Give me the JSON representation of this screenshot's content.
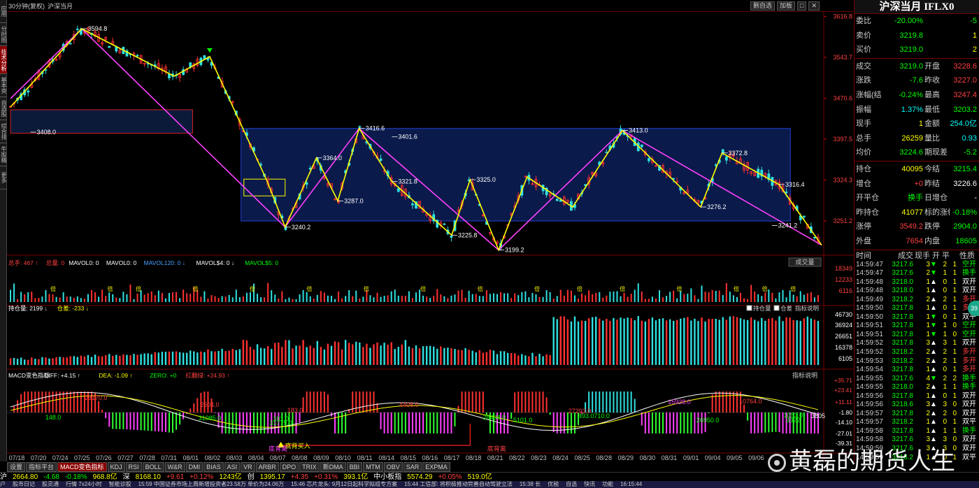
{
  "window": {
    "period": "30分钟(复权)",
    "symbol_short": "沪深当月",
    "tool_buttons": [
      "删自选",
      "加板",
      "□",
      "✕"
    ]
  },
  "left_tabs": [
    {
      "label": "应用",
      "active": false
    },
    {
      "label": "分时图",
      "active": false
    },
    {
      "label": "技术分析",
      "active": true
    },
    {
      "label": "基本资料",
      "active": false
    },
    {
      "label": "自选股",
      "active": false
    },
    {
      "label": "综合排名",
      "active": false
    },
    {
      "label": "牛股精选",
      "active": false
    },
    {
      "label": "更多",
      "active": false
    }
  ],
  "main_panel": {
    "price_ticks": [
      "3616.8",
      "3543.7",
      "3470.6",
      "3397.5",
      "3324.3",
      "3251.2"
    ],
    "annotations": [
      {
        "text": "3594.8"
      },
      {
        "text": "3408.0"
      },
      {
        "text": "3416.6"
      },
      {
        "text": "3401.6"
      },
      {
        "text": "3364.0"
      },
      {
        "text": "3321.8"
      },
      {
        "text": "3287.0"
      },
      {
        "text": "3325.0"
      },
      {
        "text": "3240.2"
      },
      {
        "text": "3225.8"
      },
      {
        "text": "3199.2"
      },
      {
        "text": "3413.0"
      },
      {
        "text": "3372.8"
      },
      {
        "text": "3316.4"
      },
      {
        "text": "3276.2"
      },
      {
        "text": "3241.2"
      }
    ]
  },
  "volume_panel": {
    "header": [
      {
        "text": "总手: 467 ↑",
        "color": "#ff4040"
      },
      {
        "text": "总量: 0",
        "color": "#ff4040"
      },
      {
        "text": "MAVOL0: 0",
        "color": "#ffffff"
      },
      {
        "text": "MAVOL0: 0",
        "color": "#ffffff"
      },
      {
        "text": "MAVOL120: 0 ↓",
        "color": "#4aa0ff"
      },
      {
        "text": "MAVOL$4: 0 ↓",
        "color": "#ffffff"
      },
      {
        "text": "MAVOL$5: 0",
        "color": "#00ff00"
      }
    ],
    "button": "成交量",
    "ticks": [
      "18349",
      "12233",
      "6116"
    ],
    "marker": "倍"
  },
  "oi_panel": {
    "header": [
      {
        "text": "持仓量: 2199 ↓",
        "color": "#ffffff"
      },
      {
        "text": "仓差: -233 ↓",
        "color": "#ffff00"
      }
    ],
    "checks": [
      "持仓量",
      "仓差",
      "指标说明"
    ],
    "ticks": [
      "46730",
      "36924",
      "26651",
      "16378",
      "6105"
    ]
  },
  "macd_panel": {
    "header": [
      {
        "text": "MACD变色指标",
        "color": "#ffffff"
      },
      {
        "text": "DIFF: +4.15 ↑",
        "color": "#ffffff"
      },
      {
        "text": "DEA: -1.09 ↑",
        "color": "#ffff00"
      },
      {
        "text": "ZERO: +0",
        "color": "#00ff00"
      },
      {
        "text": "红翻绿: +24.93 ↑",
        "color": "#ff4040"
      }
    ],
    "button": "指标说明",
    "ticks": [
      "+35.71",
      "+23.41",
      "+11.11",
      "-1.80",
      "-14.10",
      "-27.01",
      "-39.31"
    ],
    "labels": [
      {
        "text": "28170.0"
      },
      {
        "text": "2604.0"
      },
      {
        "text": "148.0"
      },
      {
        "text": "31085.0"
      },
      {
        "text": "101.0"
      },
      {
        "text": "31779.0"
      },
      {
        "text": "183.0"
      },
      {
        "text": "4408.0"
      },
      {
        "text": "28408.0"
      },
      {
        "text": "5101.0"
      },
      {
        "text": "27293.0"
      },
      {
        "text": "493.0710.0"
      },
      {
        "text": "15928.0"
      },
      {
        "text": "10764.0"
      },
      {
        "text": "26950.0"
      },
      {
        "text": "3322"
      },
      {
        "text": "1053.0"
      },
      {
        "text": "3805"
      }
    ],
    "signal_buy": "底背买入",
    "signal_top": "底背离",
    "signal_top2": "底背离"
  },
  "date_axis": [
    "07/18",
    "07/20",
    "07/24",
    "07/25",
    "07/26",
    "07/27",
    "07/28",
    "07/31",
    "08/01",
    "08/02",
    "08/03",
    "08/04",
    "08/07",
    "08/08",
    "08/09",
    "08/10",
    "08/11",
    "08/14",
    "08/15",
    "08/16",
    "08/17",
    "08/18",
    "08/21",
    "08/22",
    "08/23",
    "08/24",
    "08/25",
    "08/28",
    "08/29",
    "08/30",
    "08/31",
    "09/01",
    "09/04",
    "09/05",
    "09/06"
  ],
  "bottom_tabs": [
    {
      "label": "设置",
      "active": false
    },
    {
      "label": "指标平台",
      "active": false
    },
    {
      "label": "MACD变色指标",
      "active": true
    },
    {
      "label": "KDJ",
      "active": false
    },
    {
      "label": "RSI",
      "active": false
    },
    {
      "label": "BOLL",
      "active": false
    },
    {
      "label": "W&R",
      "active": false
    },
    {
      "label": "DMI",
      "active": false
    },
    {
      "label": "BIAS",
      "active": false
    },
    {
      "label": "ASI",
      "active": false
    },
    {
      "label": "VR",
      "active": false
    },
    {
      "label": "ARBR",
      "active": false
    },
    {
      "label": "DPO",
      "active": false
    },
    {
      "label": "TRIX",
      "active": false
    },
    {
      "label": "新DMA",
      "active": false
    },
    {
      "label": "BBI",
      "active": false
    },
    {
      "label": "MTM",
      "active": false
    },
    {
      "label": "OBV",
      "active": false
    },
    {
      "label": "SAR",
      "active": false
    },
    {
      "label": "EXPMA",
      "active": false
    }
  ],
  "index_bar": [
    {
      "text": "沪",
      "color": "#ffffff"
    },
    {
      "text": "2664.80",
      "color": "#ffff00"
    },
    {
      "text": "-4.68",
      "color": "#00ff00"
    },
    {
      "text": "-0.18%",
      "color": "#00ff00"
    },
    {
      "text": "968.8亿",
      "color": "#ffff00"
    },
    {
      "text": "深",
      "color": "#ffffff"
    },
    {
      "text": "8168.10",
      "color": "#ffff00"
    },
    {
      "text": "+9.61",
      "color": "#ff4040"
    },
    {
      "text": "+0.12%",
      "color": "#ff4040"
    },
    {
      "text": "1243亿",
      "color": "#ffff00"
    },
    {
      "text": "创",
      "color": "#ffffff"
    },
    {
      "text": "1395.17",
      "color": "#ffff00"
    },
    {
      "text": "+4.35",
      "color": "#ff4040"
    },
    {
      "text": "+0.31%",
      "color": "#ff4040"
    },
    {
      "text": "393.1亿",
      "color": "#ffff00"
    },
    {
      "text": "中小板指",
      "color": "#ffffff"
    },
    {
      "text": "5574.29",
      "color": "#ffff00"
    },
    {
      "text": "+0.05%",
      "color": "#ff4040"
    },
    {
      "text": "519.0亿",
      "color": "#ffff00"
    }
  ],
  "status_bar": [
    "户",
    "股市日记",
    "股灵通",
    "行情 7x24小时",
    "智能诊股",
    "15:59 中国证券市场上周新增投资者23.58万 单价为24.06万",
    "15:46 芯片龙头: 9月12日起科学拟组专方案",
    "15:44 工信部: 将积极推动完善自动驾驶立法",
    "15:38 长",
    "优税",
    "自选",
    "快讯",
    "功能",
    "16:15:44"
  ],
  "quote_panel": {
    "title": "沪深当月 IFLX0",
    "rows": [
      {
        "l1": "委比",
        "v1": "-20.00%",
        "c1": "#00ff00",
        "l2": "",
        "v2": "-5",
        "c2": "#00ff00"
      },
      {
        "l1": "卖价",
        "v1": "3219.8",
        "c1": "#00ff00",
        "l2": "",
        "v2": "1",
        "c2": "#ffff00"
      },
      {
        "l1": "买价",
        "v1": "3219.0",
        "c1": "#00ff00",
        "l2": "",
        "v2": "2",
        "c2": "#ffff00"
      },
      {
        "sep": true
      },
      {
        "l1": "成交",
        "v1": "3219.0",
        "c1": "#00ff00",
        "l2": "开盘",
        "v2": "3228.6",
        "c2": "#ff4040"
      },
      {
        "l1": "涨跌",
        "v1": "-7.6",
        "c1": "#00ff00",
        "l2": "昨收",
        "v2": "3227.0",
        "c2": "#ff4040"
      },
      {
        "l1": "涨幅(结)",
        "v1": "-0.24%",
        "c1": "#00ff00",
        "l2": "最高",
        "v2": "3247.4",
        "c2": "#ff4040"
      },
      {
        "l1": "振幅",
        "v1": "1.37%",
        "c1": "#00ffff",
        "l2": "最低",
        "v2": "3203.2",
        "c2": "#00ff00"
      },
      {
        "l1": "现手",
        "v1": "1",
        "c1": "#ffff00",
        "l2": "金额",
        "v2": "254.0亿",
        "c2": "#00ffff"
      },
      {
        "l1": "总手",
        "v1": "26259",
        "c1": "#ffff00",
        "l2": "量比",
        "v2": "0.93",
        "c2": "#00ffff"
      },
      {
        "l1": "均价",
        "v1": "3224.6",
        "c1": "#00ff00",
        "l2": "期现差",
        "v2": "-5.2",
        "c2": "#00ff00"
      },
      {
        "sep": true
      },
      {
        "l1": "持仓",
        "v1": "40095",
        "c1": "#ffff00",
        "l2": "今结",
        "v2": "3215.4",
        "c2": "#00ff00"
      },
      {
        "l1": "增仓",
        "v1": "+0",
        "c1": "#ff4040",
        "l2": "昨结",
        "v2": "3226.6",
        "c2": "#ffffff"
      },
      {
        "l1": "开平仓",
        "v1": "换手",
        "c1": "#00ff00",
        "l2": "日增仓",
        "v2": "-",
        "c2": "#ffffff"
      },
      {
        "l1": "昨持仓",
        "v1": "41077",
        "c1": "#ffff00",
        "l2": "标的涨幅",
        "v2": "-0.18%",
        "c2": "#00ff00"
      },
      {
        "l1": "涨停",
        "v1": "3549.2",
        "c1": "#ff4040",
        "l2": "跌停",
        "v2": "2904.0",
        "c2": "#00ff00"
      },
      {
        "l1": "外盘",
        "v1": "7654",
        "c1": "#ff4040",
        "l2": "内盘",
        "v2": "18605",
        "c2": "#00ff00"
      }
    ],
    "ticks_header": [
      "时间",
      "成交",
      "现手",
      "开",
      "平",
      "性质"
    ],
    "ticks": [
      {
        "time": "14:59:47",
        "price": "3217.6",
        "vol": "3",
        "dir": "down",
        "open": "2",
        "close": "1",
        "nat": "空开"
      },
      {
        "time": "14:59:47",
        "price": "3217.6",
        "vol": "2",
        "dir": "down",
        "open": "1",
        "close": "1",
        "nat": "换手"
      },
      {
        "time": "14:59:48",
        "price": "3218.0",
        "vol": "1",
        "dir": "up",
        "open": "0",
        "close": "1",
        "nat": "双开"
      },
      {
        "time": "14:59:48",
        "price": "3218.0",
        "vol": "1",
        "dir": "up",
        "open": "0",
        "close": "1",
        "nat": "双开"
      },
      {
        "time": "14:59:49",
        "price": "3218.2",
        "vol": "2",
        "dir": "up",
        "open": "2",
        "close": "1",
        "nat": "多开"
      },
      {
        "time": "14:59:50",
        "price": "3217.8",
        "vol": "1",
        "dir": "up",
        "open": "0",
        "close": "1",
        "nat": "多开"
      },
      {
        "time": "14:59:50",
        "price": "3217.8",
        "vol": "1",
        "dir": "down",
        "open": "0",
        "close": "1",
        "nat": "双平"
      },
      {
        "time": "14:59:51",
        "price": "3217.8",
        "vol": "1",
        "dir": "down",
        "open": "1",
        "close": "0",
        "nat": "空开"
      },
      {
        "time": "14:59:51",
        "price": "3217.8",
        "vol": "1",
        "dir": "down",
        "open": "1",
        "close": "0",
        "nat": "空开"
      },
      {
        "time": "14:59:52",
        "price": "3217.8",
        "vol": "3",
        "dir": "up",
        "open": "3",
        "close": "1",
        "nat": "双开"
      },
      {
        "time": "14:59:52",
        "price": "3218.2",
        "vol": "2",
        "dir": "up",
        "open": "2",
        "close": "1",
        "nat": "多开"
      },
      {
        "time": "14:59:53",
        "price": "3218.2",
        "vol": "2",
        "dir": "up",
        "open": "2",
        "close": "1",
        "nat": "多开"
      },
      {
        "time": "14:59:54",
        "price": "3217.8",
        "vol": "1",
        "dir": "up",
        "open": "0",
        "close": "1",
        "nat": "多开"
      },
      {
        "time": "14:59:55",
        "price": "3217.6",
        "vol": "4",
        "dir": "down",
        "open": "2",
        "close": "2",
        "nat": "换手"
      },
      {
        "time": "14:59:55",
        "price": "3218.0",
        "vol": "2",
        "dir": "up",
        "open": "1",
        "close": "1",
        "nat": "换手"
      },
      {
        "time": "14:59:56",
        "price": "3217.8",
        "vol": "1",
        "dir": "up",
        "open": "0",
        "close": "1",
        "nat": "双开"
      },
      {
        "time": "14:59:56",
        "price": "3218.6",
        "vol": "3",
        "dir": "up",
        "open": "3",
        "close": "0",
        "nat": "双开"
      },
      {
        "time": "14:59:57",
        "price": "3217.8",
        "vol": "2",
        "dir": "up",
        "open": "2",
        "close": "0",
        "nat": "双开"
      },
      {
        "time": "14:59:57",
        "price": "3218.2",
        "vol": "1",
        "dir": "up",
        "open": "0",
        "close": "1",
        "nat": "双平"
      },
      {
        "time": "14:59:58",
        "price": "3217.8",
        "vol": "1",
        "dir": "up",
        "open": "1",
        "close": "1",
        "nat": "换手"
      },
      {
        "time": "14:59:58",
        "price": "3217.6",
        "vol": "3",
        "dir": "up",
        "open": "3",
        "close": "0",
        "nat": "双开"
      },
      {
        "time": "14:59:59",
        "price": "3217.6",
        "vol": "3",
        "dir": "up",
        "open": "3",
        "close": "0",
        "nat": "双开"
      },
      {
        "time": "14:59:59",
        "price": "3218.2",
        "vol": "1",
        "dir": "up",
        "open": "0",
        "close": "1",
        "nat": "双平"
      },
      {
        "time": "14:59:59",
        "price": "3218.2",
        "vol": "2",
        "dir": "down",
        "open": "1",
        "close": "1",
        "nat": "多开"
      }
    ]
  },
  "side_badge": "39",
  "watermark": "黄磊的期货人生",
  "chart_data": {
    "type": "candlestick",
    "x": [
      "07/18",
      "07/20",
      "07/24",
      "07/25",
      "07/26",
      "07/27",
      "07/28",
      "07/31",
      "08/01",
      "08/02",
      "08/03",
      "08/04",
      "08/07",
      "08/08",
      "08/09",
      "08/10",
      "08/11",
      "08/14",
      "08/15",
      "08/16",
      "08/17",
      "08/18",
      "08/21",
      "08/22",
      "08/23",
      "08/24",
      "08/25",
      "08/28",
      "08/29",
      "08/30",
      "08/31",
      "09/01",
      "09/04",
      "09/05",
      "09/06"
    ],
    "ylim": [
      3190,
      3625
    ],
    "zigzag_points": [
      [
        0,
        3455
      ],
      [
        5,
        3594.8
      ],
      [
        11.5,
        3510
      ],
      [
        14,
        3545
      ],
      [
        18,
        3324.3
      ],
      [
        19.3,
        3240.2
      ],
      [
        21.5,
        3364.0
      ],
      [
        23,
        3287.0
      ],
      [
        24.5,
        3416.6
      ],
      [
        26.8,
        3321.8
      ],
      [
        31,
        3225.8
      ],
      [
        32.3,
        3325.0
      ],
      [
        34.3,
        3199.2
      ],
      [
        36.3,
        3330
      ],
      [
        39.5,
        3276
      ],
      [
        43,
        3413.0
      ],
      [
        48.5,
        3276.2
      ],
      [
        50,
        3372.8
      ],
      [
        54,
        3316.4
      ],
      [
        57,
        3208
      ]
    ],
    "channel_points": [
      [
        0,
        3470
      ],
      [
        5,
        3594.8
      ],
      [
        19.3,
        3240.2
      ],
      [
        24.5,
        3416.6
      ],
      [
        34.3,
        3199.2
      ],
      [
        43,
        3413.0
      ],
      [
        57,
        3208
      ]
    ],
    "zones": [
      {
        "name": "left-zone",
        "x0": 0,
        "x1": 12.8,
        "y0": 3408,
        "y1": 3450
      },
      {
        "name": "box-range",
        "x0": 16.2,
        "x1": 54.8,
        "y0": 3251.2,
        "y1": 3416.6
      },
      {
        "name": "small-box",
        "x0": 16.4,
        "x1": 19.3,
        "y0": 3296,
        "y1": 3326
      }
    ]
  }
}
